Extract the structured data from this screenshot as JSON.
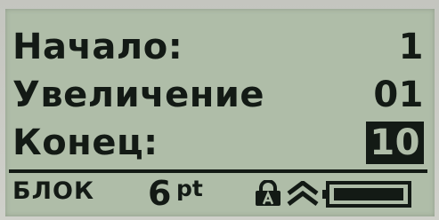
{
  "fields": [
    {
      "label": "Начало:",
      "value": "1"
    },
    {
      "label": "Увеличение",
      "value": "01"
    },
    {
      "label": "Конец:",
      "value": "10"
    }
  ],
  "status": {
    "mode": "БЛОК",
    "font_size": "6",
    "font_unit": "pt",
    "icons": [
      "caps-lock-icon",
      "caps-arrows-icon",
      "battery-icon"
    ]
  },
  "colors": {
    "screen_bg": "#afbda8",
    "ink": "#131a15"
  }
}
